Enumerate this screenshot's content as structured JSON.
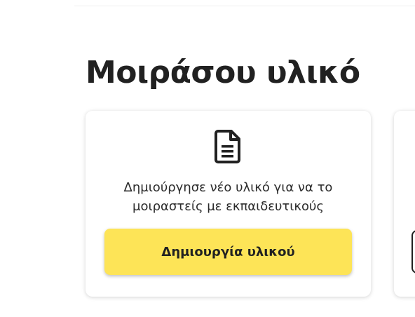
{
  "section": {
    "title": "Μοιράσου υλικό"
  },
  "cards": [
    {
      "icon": "document-icon",
      "description_line1": "Δημιούργησε νέο υλικό για να το",
      "description_line2": "μοιραστείς με εκπαιδευτικούς",
      "button_label": "Δημιουργία υλικού"
    }
  ],
  "colors": {
    "accent_button": "#fde457",
    "text_dark": "#212121",
    "background": "#ffffff"
  }
}
